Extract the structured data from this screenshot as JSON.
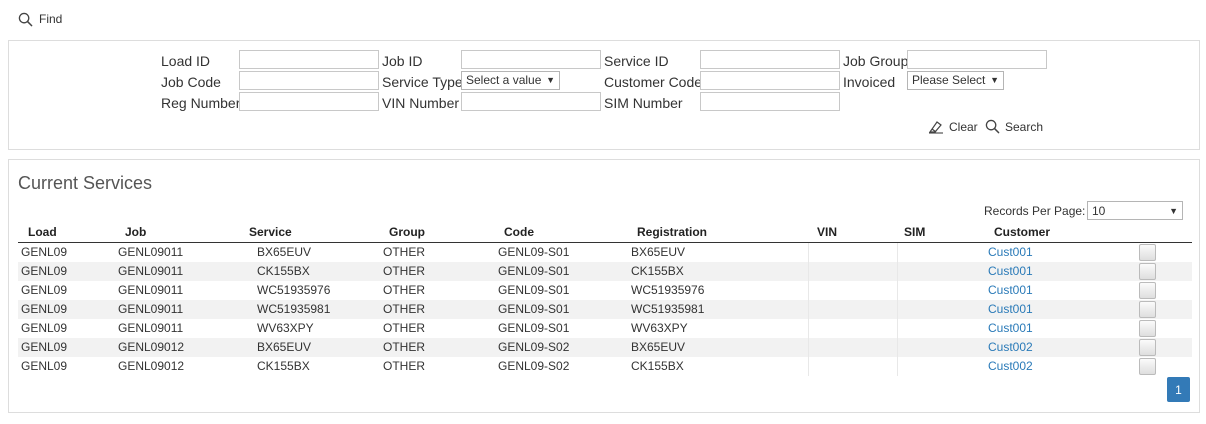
{
  "find": {
    "label": "Find"
  },
  "filters": {
    "load_id": "Load ID",
    "job_id": "Job ID",
    "service_id": "Service ID",
    "job_group": "Job Group",
    "job_code": "Job Code",
    "service_type": "Service Type",
    "service_type_value": "Select a value",
    "customer_code": "Customer Code",
    "invoiced": "Invoiced",
    "invoiced_value": "Please Select",
    "reg_number": "Reg Number",
    "vin_number": "VIN Number",
    "sim_number": "SIM Number",
    "clear_label": "Clear",
    "search_label": "Search"
  },
  "results": {
    "title": "Current Services",
    "records_per_page_label": "Records Per Page:",
    "records_per_page_value": "10",
    "columns": [
      "Load",
      "Job",
      "Service",
      "Group",
      "Code",
      "Registration",
      "VIN",
      "SIM",
      "Customer"
    ],
    "rows": [
      [
        "GENL09",
        "GENL09011",
        "BX65EUV",
        "OTHER",
        "GENL09-S01",
        "BX65EUV",
        "",
        "",
        "Cust001"
      ],
      [
        "GENL09",
        "GENL09011",
        "CK155BX",
        "OTHER",
        "GENL09-S01",
        "CK155BX",
        "",
        "",
        "Cust001"
      ],
      [
        "GENL09",
        "GENL09011",
        "WC51935976",
        "OTHER",
        "GENL09-S01",
        "WC51935976",
        "",
        "",
        "Cust001"
      ],
      [
        "GENL09",
        "GENL09011",
        "WC51935981",
        "OTHER",
        "GENL09-S01",
        "WC51935981",
        "",
        "",
        "Cust001"
      ],
      [
        "GENL09",
        "GENL09011",
        "WV63XPY",
        "OTHER",
        "GENL09-S01",
        "WV63XPY",
        "",
        "",
        "Cust001"
      ],
      [
        "GENL09",
        "GENL09012",
        "BX65EUV",
        "OTHER",
        "GENL09-S02",
        "BX65EUV",
        "",
        "",
        "Cust002"
      ],
      [
        "GENL09",
        "GENL09012",
        "CK155BX",
        "OTHER",
        "GENL09-S02",
        "CK155BX",
        "",
        "",
        "Cust002"
      ]
    ],
    "page": "1"
  },
  "colors": {
    "accent": "#337ab7",
    "link": "#2a7ab8",
    "alt_row": "#f2f2f2"
  },
  "icons": {
    "find": "search-icon",
    "clear": "eraser-icon",
    "search": "search-icon"
  }
}
